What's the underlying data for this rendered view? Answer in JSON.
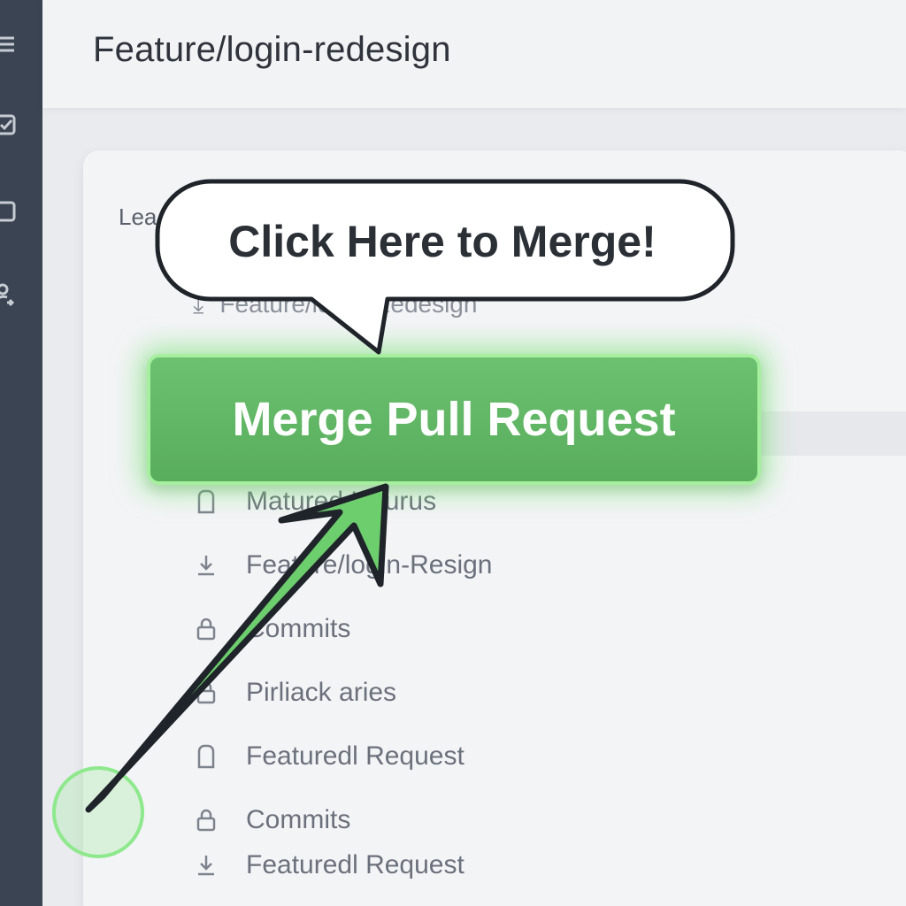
{
  "header": {
    "title": "Feature/login-redesign"
  },
  "panel": {
    "subtitle": "Lea",
    "branch_label": "Feature/login-Redesign"
  },
  "sidebar": {
    "icons": [
      "menu-icon",
      "checkbox-icon",
      "square-icon",
      "user-share-icon"
    ]
  },
  "list": {
    "items": [
      {
        "icon": "file-icon",
        "label": "Matured Hourus"
      },
      {
        "icon": "download-icon",
        "label": "Feature/login-Resign"
      },
      {
        "icon": "lock-icon",
        "label": "Commits"
      },
      {
        "icon": "lock-icon",
        "label": "Pirliack aries"
      },
      {
        "icon": "file-icon",
        "label": "Featuredl Request"
      },
      {
        "icon": "lock-icon",
        "label": "Commits"
      },
      {
        "icon": "download-icon",
        "label": "Featuredl Request"
      }
    ]
  },
  "merge": {
    "button_label": "Merge Pull Request"
  },
  "callout": {
    "text": "Click Here to Merge!"
  },
  "colors": {
    "accent_green": "#5cb760",
    "glow_green": "#8ee88c",
    "sidebar": "#3a4452"
  }
}
